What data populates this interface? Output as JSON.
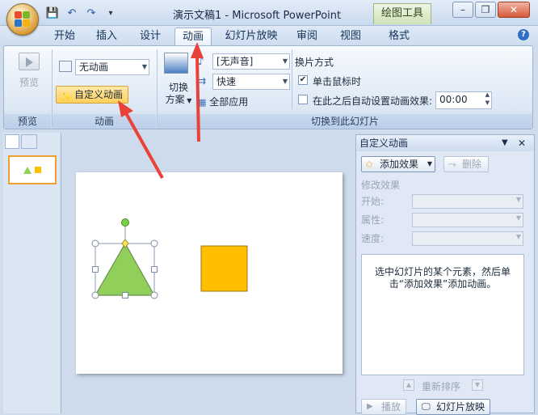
{
  "window": {
    "title": "演示文稿1 - Microsoft PowerPoint",
    "context_tab_title": "绘图工具",
    "minimize": "–",
    "restore": "❐",
    "close": "✕"
  },
  "qat": {
    "save": "💾",
    "undo": "↶",
    "redo": "↷",
    "more": "▾"
  },
  "tabs": [
    {
      "label": "开始"
    },
    {
      "label": "插入"
    },
    {
      "label": "设计"
    },
    {
      "label": "动画"
    },
    {
      "label": "幻灯片放映"
    },
    {
      "label": "审阅"
    },
    {
      "label": "视图"
    },
    {
      "label": "格式"
    }
  ],
  "help": "?",
  "ribbon": {
    "preview": {
      "button": "预览",
      "group": "预览"
    },
    "animation": {
      "no_animation": "无动画",
      "custom_animation": "自定义动画",
      "group": "动画"
    },
    "transition": {
      "switch_scheme_line1": "切换",
      "switch_scheme_line2": "方案",
      "sound": "[无声音]",
      "speed": "快速",
      "apply_all": "全部应用",
      "advance_header": "换片方式",
      "on_click": "单击鼠标时",
      "on_click_checked": true,
      "auto_after": "在此之后自动设置动画效果:",
      "auto_after_checked": false,
      "time": "00:00",
      "group": "切换到此幻灯片"
    }
  },
  "slide_pane": {
    "slide_number": "1"
  },
  "task_pane": {
    "title": "自定义动画",
    "add_effect": "添加效果",
    "remove": "删除",
    "modify_header": "修改效果",
    "start_label": "开始:",
    "property_label": "属性:",
    "speed_label": "速度:",
    "hint": "选中幻灯片的某个元素，然后单击“添加效果”添加动画。",
    "reorder": "重新排序",
    "play": "播放",
    "slideshow": "幻灯片放映"
  },
  "colors": {
    "triangle": "#8fcf5a",
    "square": "#ffbf00",
    "arrow": "#e8423a"
  }
}
